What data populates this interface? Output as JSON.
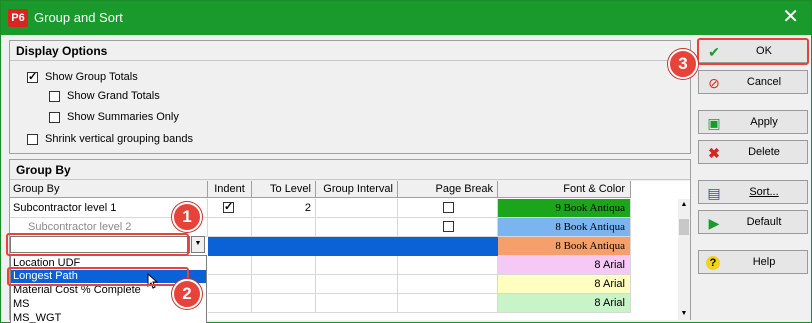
{
  "window": {
    "app_icon": "P6",
    "title": "Group and Sort",
    "close_glyph": "✕"
  },
  "display_options": {
    "header": "Display Options",
    "show_group_totals": {
      "label": "Show Group Totals",
      "checked": true
    },
    "show_grand_totals": {
      "label": "Show Grand Totals",
      "checked": false
    },
    "show_summaries_only": {
      "label": "Show Summaries Only",
      "checked": false
    },
    "shrink_bands": {
      "label": "Shrink vertical grouping bands",
      "checked": false
    }
  },
  "group_by": {
    "header": "Group By",
    "columns": [
      "Group By",
      "Indent",
      "To Level",
      "Group Interval",
      "Page Break",
      "Font & Color"
    ],
    "rows": [
      {
        "group_by": "Subcontractor level 1",
        "indent": true,
        "to_level": "2",
        "group_interval": "",
        "page_break": false,
        "font": "9 Book Antiqua",
        "color": "#1aa51a"
      },
      {
        "group_by": "Subcontractor level 2",
        "indent": null,
        "to_level": "",
        "group_interval": "",
        "page_break": false,
        "font": "8 Book Antiqua",
        "color": "#7cb4f0"
      },
      {
        "group_by": "",
        "indent": null,
        "to_level": "",
        "group_interval": "",
        "page_break": null,
        "font": "8 Book Antiqua",
        "color": "#f5a06a"
      },
      {
        "group_by": "",
        "font": "8 Arial",
        "color": "#f6c8f6"
      },
      {
        "group_by": "",
        "font": "8 Arial",
        "color": "#ffffc0"
      },
      {
        "group_by": "",
        "font": "8 Arial",
        "color": "#c8f5c8"
      }
    ],
    "dropdown_options": [
      "Location UDF",
      "Longest Path",
      "Material Cost % Complete",
      "MS",
      "MS_WGT"
    ],
    "dropdown_selected": "Longest Path"
  },
  "buttons": {
    "ok": "OK",
    "cancel": "Cancel",
    "apply": "Apply",
    "delete": "Delete",
    "sort": "Sort...",
    "default": "Default",
    "help": "Help"
  },
  "callouts": [
    "1",
    "2",
    "3"
  ],
  "colors": {
    "titlebar": "#1a9a2c",
    "callout": "#e8433a",
    "selection": "#0a62d6"
  }
}
